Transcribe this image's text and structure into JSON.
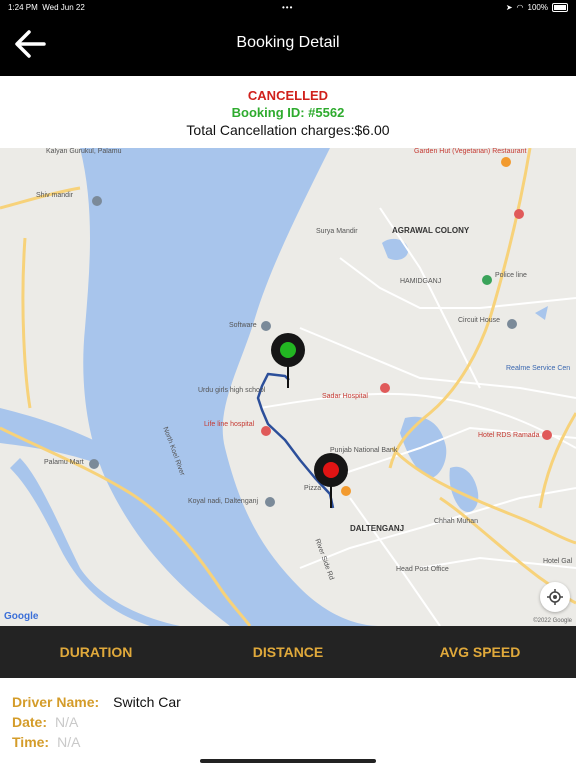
{
  "status_bar": {
    "time": "1:24 PM",
    "date": "Wed Jun 22",
    "dots": "•••",
    "battery": "100%"
  },
  "header": {
    "title": "Booking Detail"
  },
  "booking": {
    "status": "CANCELLED",
    "booking_id": "Booking ID: #5562",
    "charges": "Total Cancellation charges:$6.00"
  },
  "map": {
    "labels": {
      "kalyan": "Kalyan Gurukul, Palamu",
      "shiv": "Shiv mandir",
      "surya": "Surya Mandir",
      "agrawal": "AGRAWAL COLONY",
      "hamidganj": "HAMIDGANJ",
      "police": "Police line",
      "circuit": "Circuit House",
      "realme": "Realme Service Cen",
      "software": "Software",
      "urdu": "Urdu girls high school",
      "sadar": "Sadar Hospital",
      "lifeline": "Life line hospital",
      "punjab": "Punjab National Bank",
      "rds": "Hotel RDS Ramada",
      "pizza": "Pizza",
      "palamu": "Palamu Mart",
      "koyal": "Koyal nadi, Daltenganj",
      "daltenganj": "DALTENGANJ",
      "chhah": "Chhah Muhan",
      "headpost": "Head Post Office",
      "garden": "Garden Hut (Vegetarian) Restaurant",
      "hotelga": "Hotel Gal",
      "north_koel": "North Koel River",
      "river_side": "River Side Rd",
      "google": "Google",
      "copyright": "©2022 Google"
    }
  },
  "stats": {
    "duration": "DURATION",
    "distance": "DISTANCE",
    "avg_speed": "AVG SPEED"
  },
  "details": {
    "driver_label": "Driver Name:",
    "driver_value": "Switch Car",
    "date_label": "Date:",
    "date_value": "N/A",
    "time_label": "Time:",
    "time_value": "N/A"
  },
  "colors": {
    "cancelled": "#d0211c",
    "booking_id": "#2eab2e",
    "accent": "#e0a93b",
    "route": "#2c4f9a",
    "start_marker": "#22b622",
    "end_marker": "#e01414"
  }
}
